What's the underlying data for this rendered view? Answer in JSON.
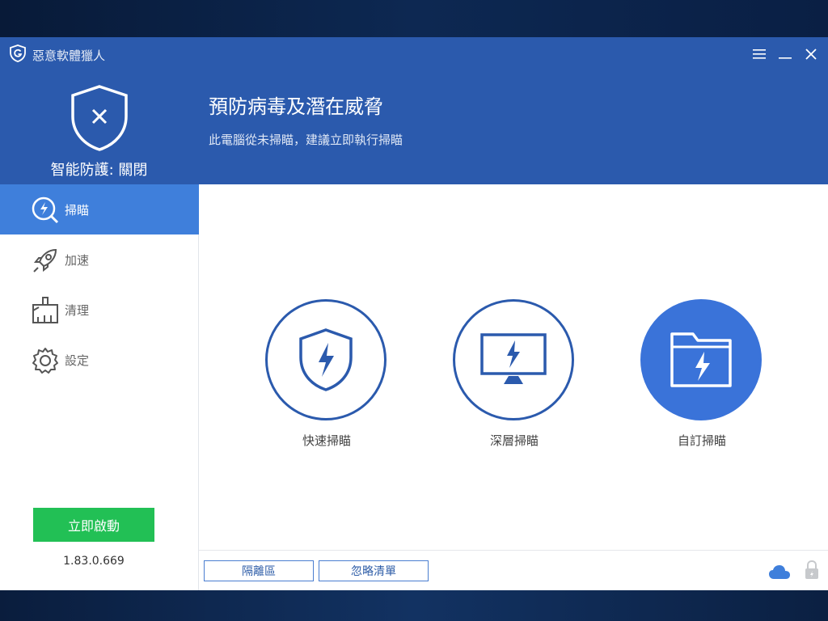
{
  "app": {
    "title": "惡意軟體獵人"
  },
  "header": {
    "protection_status": "智能防護: 關閉",
    "headline": "預防病毒及潛在威脅",
    "subline": "此電腦從未掃瞄，建議立即執行掃瞄"
  },
  "sidebar": {
    "items": [
      {
        "label": "掃瞄",
        "icon": "scan-icon",
        "active": true
      },
      {
        "label": "加速",
        "icon": "rocket-icon",
        "active": false
      },
      {
        "label": "清理",
        "icon": "broom-icon",
        "active": false
      },
      {
        "label": "設定",
        "icon": "gear-icon",
        "active": false
      }
    ],
    "start_button": "立即啟動",
    "version": "1.83.0.669"
  },
  "scan_options": [
    {
      "label": "快速掃瞄",
      "icon": "shield-bolt-icon"
    },
    {
      "label": "深層掃瞄",
      "icon": "monitor-bolt-icon"
    },
    {
      "label": "自訂掃瞄",
      "icon": "folder-bolt-icon",
      "selected": true
    }
  ],
  "footer": {
    "quarantine_button": "隔離區",
    "ignore_list_button": "忽略清單"
  },
  "colors": {
    "header_blue": "#2b5aad",
    "active_blue": "#3f7fdb",
    "start_green": "#22c055"
  }
}
